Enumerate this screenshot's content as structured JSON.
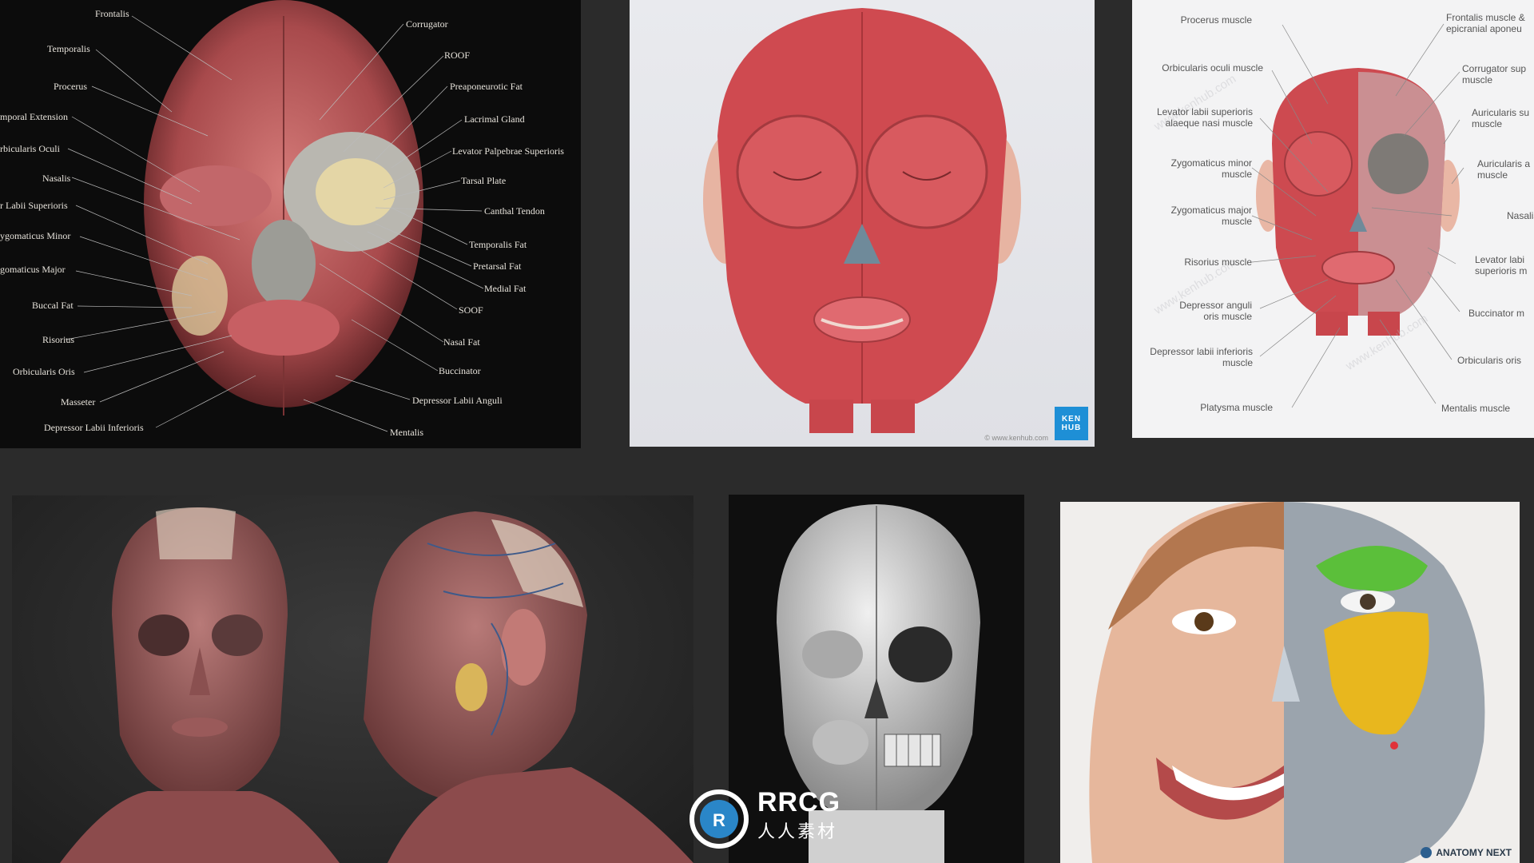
{
  "panel_a": {
    "labels_left": [
      "Frontalis",
      "Temporalis",
      "Procerus",
      "mporal Extension",
      "rbicularis Oculi",
      "Nasalis",
      "r Labii Superioris",
      "ygomaticus Minor",
      "gomaticus Major",
      "Buccal Fat",
      "Risorius",
      "Orbicularis Oris",
      "Masseter",
      "Depressor Labii Inferioris"
    ],
    "labels_right": [
      "Corrugator",
      "ROOF",
      "Preaponeurotic Fat",
      "Lacrimal Gland",
      "Levator Palpebrae Superioris",
      "Tarsal Plate",
      "Canthal Tendon",
      "Temporalis Fat",
      "Pretarsal Fat",
      "Medial Fat",
      "SOOF",
      "Nasal Fat",
      "Buccinator",
      "Depressor Labii Anguli",
      "Mentalis"
    ]
  },
  "panel_b": {
    "badge_line1": "KEN",
    "badge_line2": "HUB",
    "credit": "© www.kenhub.com"
  },
  "panel_c": {
    "labels_left": [
      "Procerus muscle",
      "Orbicularis oculi muscle",
      "Levator labii superioris\nalaeque nasi muscle",
      "Zygomaticus minor\nmuscle",
      "Zygomaticus major\nmuscle",
      "Risorius muscle",
      "Depressor anguli\noris muscle",
      "Depressor labii inferioris\nmuscle",
      "Platysma muscle"
    ],
    "labels_right": [
      "Frontalis muscle &\nepicranial aponeu",
      "Corrugator sup\nmuscle",
      "Auricularis su\nmuscle",
      "Auricularis a\nmuscle",
      "Nasalis mus",
      "Levator labi\nsuperioris m",
      "Buccinator m",
      "Orbicularis oris",
      "Mentalis muscle"
    ],
    "watermark": "www.kenhub.com"
  },
  "panel_f": {
    "logo": "ANATOMY NEXT"
  },
  "watermark": {
    "name": "RRCG",
    "cn": "人人素材"
  },
  "colors": {
    "background": "#2b2b2b",
    "muscle_red": "#c9454a",
    "kenhub_blue": "#1e8fd6",
    "fat_yellow": "#e8b71e",
    "highlight_green": "#5bbf3a"
  }
}
